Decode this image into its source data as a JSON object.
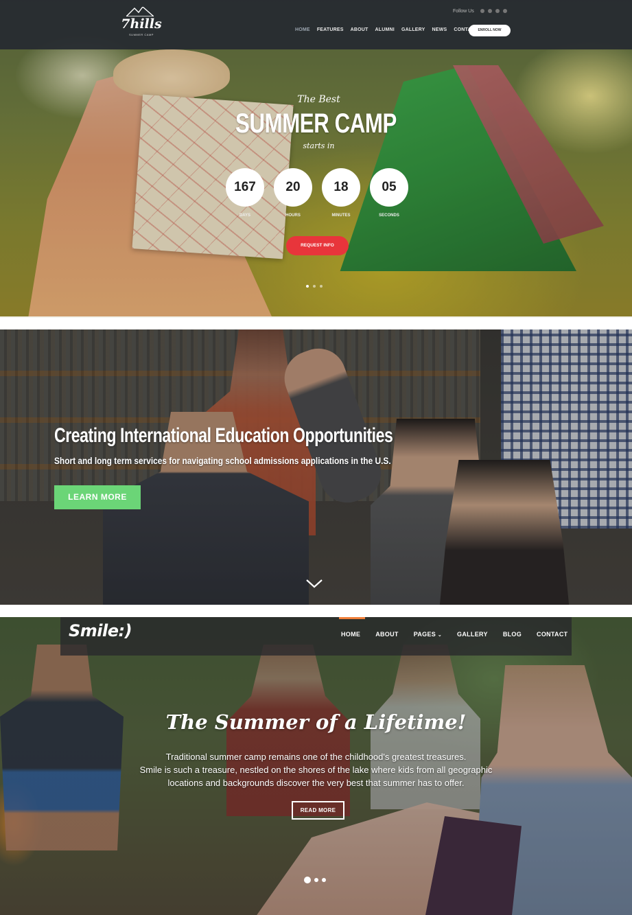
{
  "panel_7hills": {
    "logo": {
      "name": "7hills",
      "tagline": "SUMMER CAMP"
    },
    "follow_label": "Follow Us",
    "social_icons": [
      "facebook-icon",
      "instagram-icon",
      "twitter-icon",
      "pinterest-icon"
    ],
    "menu": [
      "HOME",
      "FEATURES",
      "ABOUT",
      "ALUMNI",
      "GALLERY",
      "NEWS",
      "CONTACTS"
    ],
    "active_menu": "HOME",
    "enroll_label": "ENROLL NOW",
    "pre_title": "The Best",
    "title": "SUMMER CAMP",
    "post_title": "starts in",
    "countdown": [
      {
        "value": "167",
        "label": "DAYS"
      },
      {
        "value": "20",
        "label": "HOURS"
      },
      {
        "value": "18",
        "label": "MINUTES"
      },
      {
        "value": "05",
        "label": "SECONDS"
      }
    ],
    "request_label": "REQUEST INFO",
    "slides": 3,
    "active_slide": 1,
    "accent_color": "#e8353b"
  },
  "panel_education": {
    "heading": "Creating International Education Opportunities",
    "subheading": "Short and long term services for navigating school admissions applications in the U.S.",
    "cta_label": "LEARN MORE",
    "cta_color": "#6bd577",
    "scroll_icon": "chevron-down-icon"
  },
  "panel_smile": {
    "logo": "Smile:)",
    "menu": [
      "HOME",
      "ABOUT",
      "PAGES",
      "GALLERY",
      "BLOG",
      "CONTACT"
    ],
    "active_menu": "HOME",
    "accent_color": "#f07f3a",
    "title": "The Summer of a Lifetime!",
    "body": [
      "Traditional summer camp remains one of the childhood's greatest treasures.",
      "Smile is such a treasure, nestled on the shores of the lake where kids from all geographic",
      "locations and backgrounds discover the very best that summer has to offer."
    ],
    "cta_label": "READ MORE",
    "slides": 3,
    "active_slide": 1
  }
}
